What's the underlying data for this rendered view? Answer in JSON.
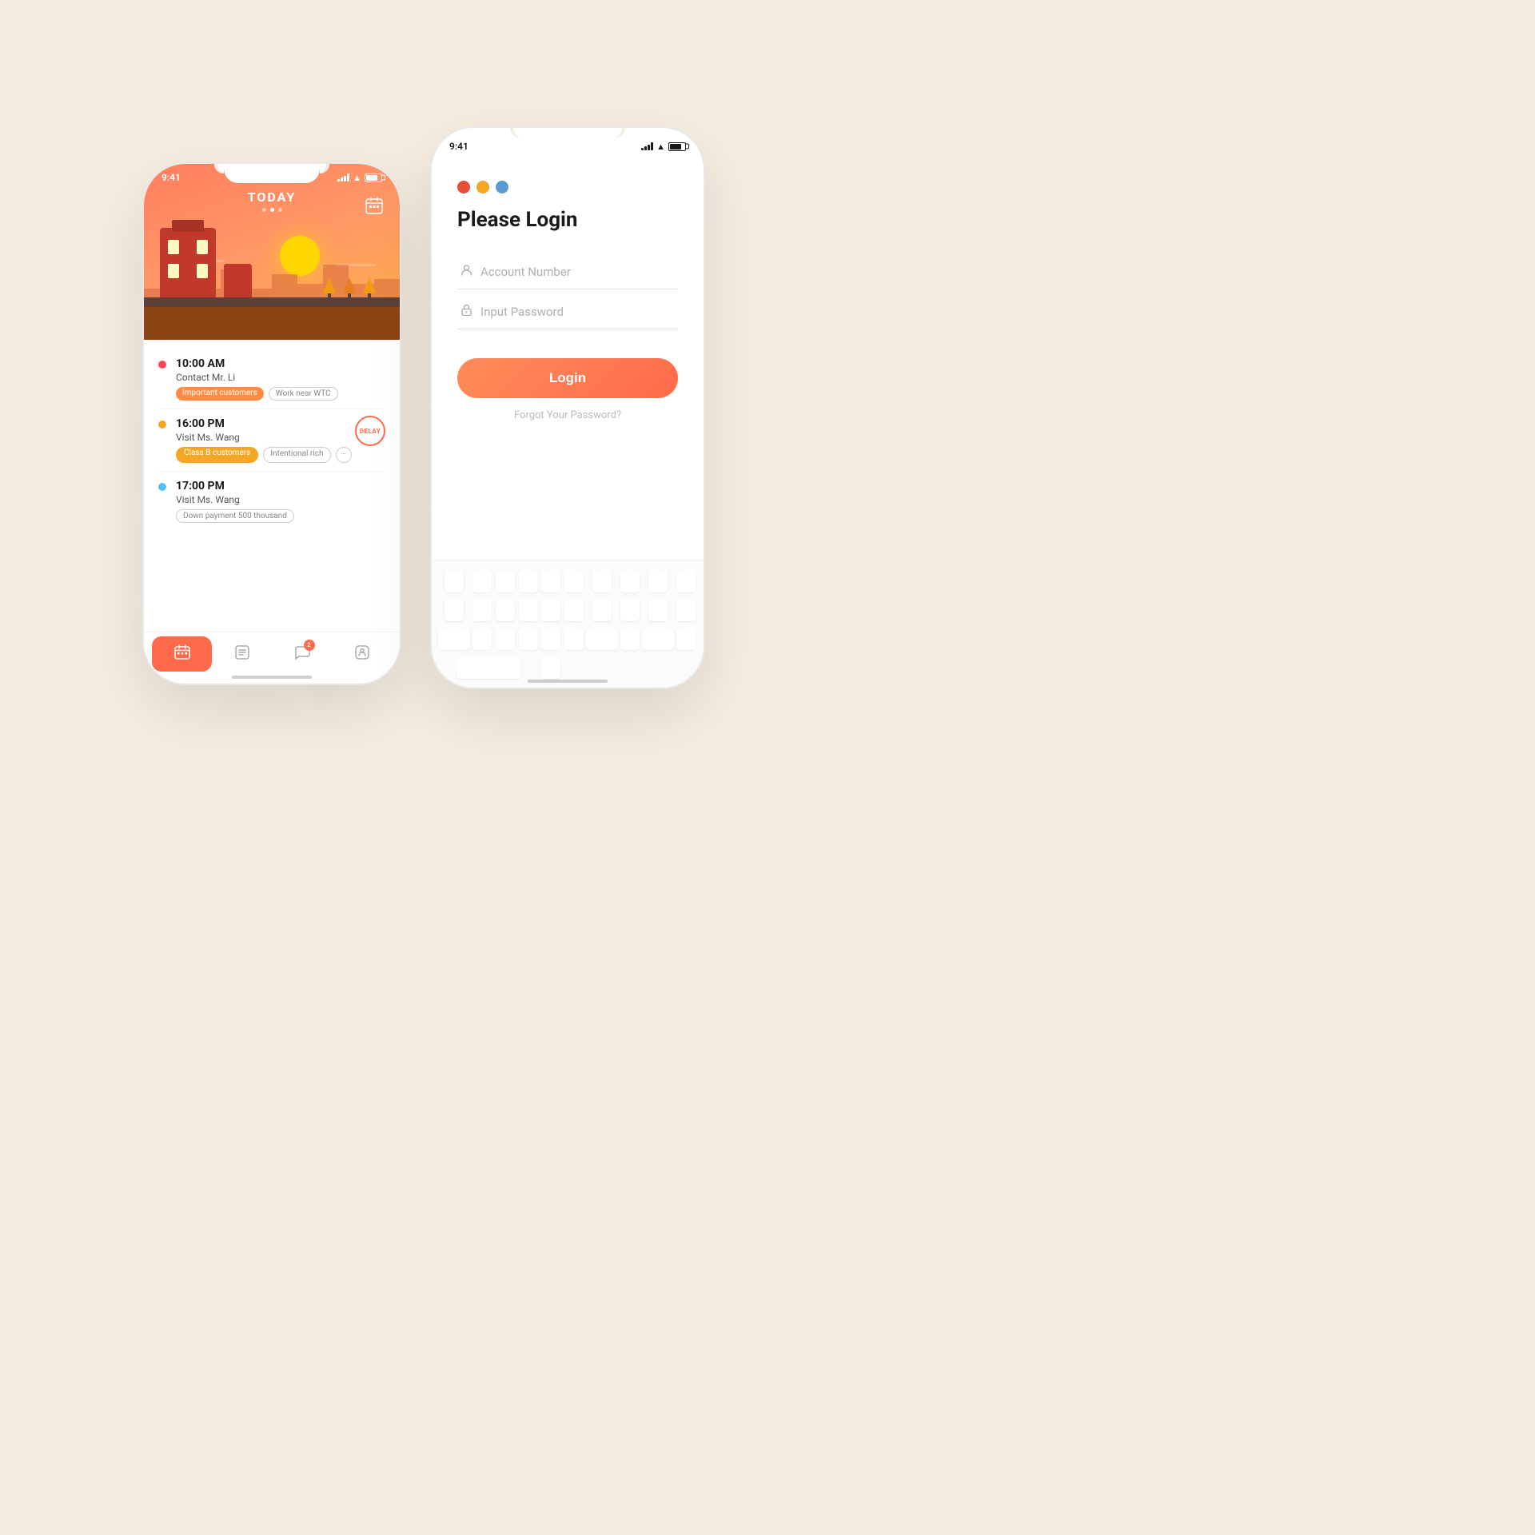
{
  "scene": {
    "bg_color": "#f5ede0"
  },
  "phone_left": {
    "status": {
      "time": "9:41",
      "signal_bars": 4,
      "wifi": true,
      "battery": 75
    },
    "hero": {
      "label": "TODAY",
      "dots": [
        false,
        true,
        false
      ]
    },
    "schedule": [
      {
        "time": "10:00 AM",
        "title": "Contact Mr. Li",
        "dot_color": "#ff4757",
        "tags": [
          {
            "label": "Important customers",
            "type": "orange"
          },
          {
            "label": "Work near WTC",
            "type": "outline"
          }
        ],
        "badge": null
      },
      {
        "time": "16:00 PM",
        "title": "Visit Ms. Wang",
        "dot_color": "#f5a623",
        "tags": [
          {
            "label": "Class B customers",
            "type": "yellow"
          },
          {
            "label": "Intentional rich",
            "type": "outline"
          },
          {
            "label": "...",
            "type": "dots"
          }
        ],
        "badge": "DELAY"
      },
      {
        "time": "17:00 PM",
        "title": "Visit Ms. Wang",
        "dot_color": "#4fc3f7",
        "tags": [
          {
            "label": "Down payment 500 thousand",
            "type": "outline"
          }
        ],
        "badge": null
      }
    ],
    "nav": {
      "items": [
        {
          "icon": "📅",
          "active": true,
          "badge": null
        },
        {
          "icon": "📋",
          "active": false,
          "badge": null
        },
        {
          "icon": "💬",
          "active": false,
          "badge": "2"
        },
        {
          "icon": "😊",
          "active": false,
          "badge": null
        }
      ]
    }
  },
  "phone_right": {
    "status": {
      "time": "9:41",
      "signal_bars": 4,
      "wifi": true,
      "battery": 75
    },
    "color_dots": [
      "#e74c3c",
      "#f5a623",
      "#5b9bd5"
    ],
    "title": "Please Login",
    "account_placeholder": "Account Number",
    "password_placeholder": "Input Password",
    "login_btn_label": "Login",
    "forgot_password_label": "Forgot Your Password?"
  }
}
